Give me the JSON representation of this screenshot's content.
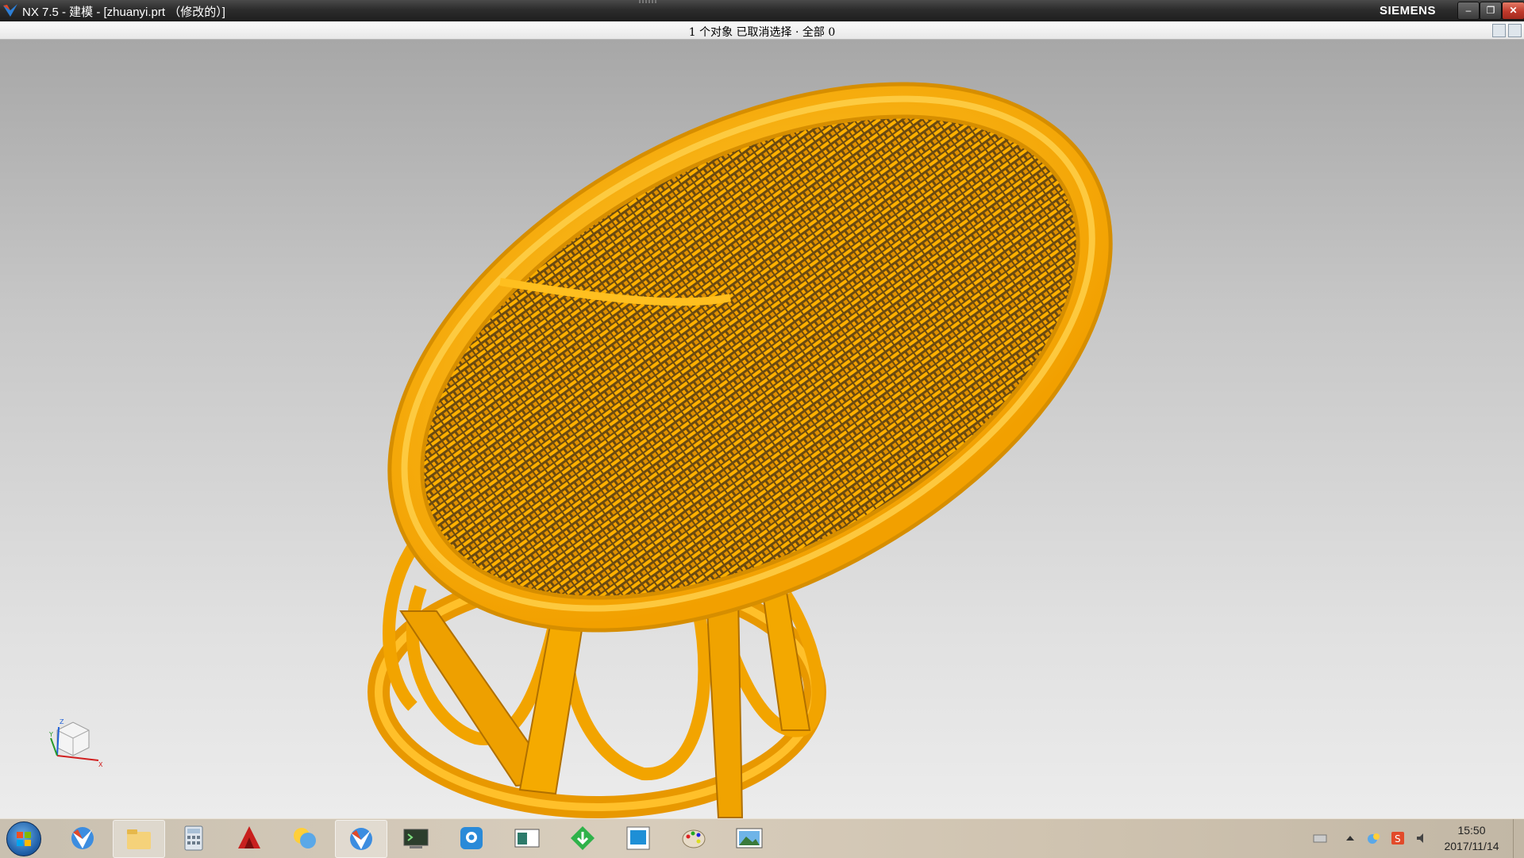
{
  "window": {
    "title": "NX 7.5 - 建模 - [zhuanyi.prt （修改的）]",
    "brand": "SIEMENS",
    "controls": {
      "minimize": "–",
      "maximize": "❐",
      "close": "✕"
    }
  },
  "statusbar": {
    "message": "1 个对象 已取消选择 · 全部 0"
  },
  "viewport": {
    "model_color": "#ffb000",
    "background_top": "#a7a7a7",
    "background_bottom": "#ececec",
    "triad_labels": {
      "x": "X",
      "y": "Y",
      "z": "Z"
    }
  },
  "taskbar": {
    "items": [
      {
        "name": "nx-app",
        "icon": "nx-icon"
      },
      {
        "name": "file-explorer",
        "icon": "folder-icon"
      },
      {
        "name": "calculator",
        "icon": "calculator-icon"
      },
      {
        "name": "autocad",
        "icon": "autocad-icon"
      },
      {
        "name": "messenger",
        "icon": "chat-icon"
      },
      {
        "name": "nx-active",
        "icon": "nx-icon",
        "active": true
      },
      {
        "name": "terminal",
        "icon": "terminal-icon"
      },
      {
        "name": "qq",
        "icon": "qq-icon"
      },
      {
        "name": "window-app",
        "icon": "window-icon"
      },
      {
        "name": "download",
        "icon": "download-icon"
      },
      {
        "name": "blue-app",
        "icon": "blue-square-icon"
      },
      {
        "name": "paint",
        "icon": "palette-icon"
      },
      {
        "name": "image-viewer",
        "icon": "picture-icon"
      }
    ],
    "clock": {
      "time": "15:50",
      "date": "2017/11/14"
    }
  }
}
